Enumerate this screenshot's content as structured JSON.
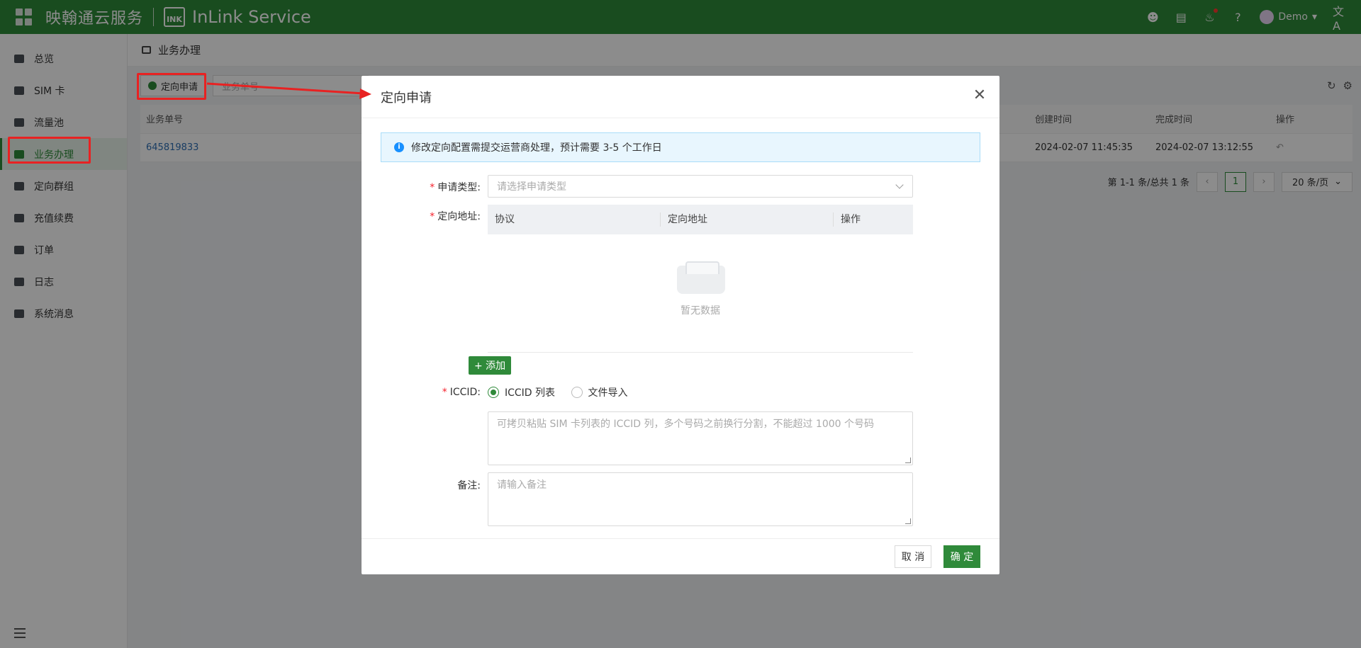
{
  "header": {
    "brand_cn": "映翰通云服务",
    "brand_en": "InLink Service",
    "logo_text": "INK",
    "user": "Demo",
    "user_caret": "▾",
    "lang_icon": "文A"
  },
  "sidebar": {
    "items": [
      {
        "label": "总览"
      },
      {
        "label": "SIM 卡"
      },
      {
        "label": "流量池"
      },
      {
        "label": "业务办理"
      },
      {
        "label": "定向群组"
      },
      {
        "label": "充值续费"
      },
      {
        "label": "订单"
      },
      {
        "label": "日志"
      },
      {
        "label": "系统消息"
      }
    ]
  },
  "page": {
    "title": "业务办理",
    "apply_button": "定向申请",
    "search_placeholder": "业务单号",
    "table": {
      "columns": [
        "业务单号",
        "创建时间",
        "完成时间",
        "操作"
      ],
      "rows": [
        {
          "order_no": "645819833",
          "created": "2024-02-07 11:45:35",
          "finished": "2024-02-07 13:12:55"
        }
      ]
    },
    "pager": {
      "summary": "第 1-1 条/总共 1 条",
      "current_page": "1",
      "page_size": "20 条/页"
    }
  },
  "modal": {
    "title": "定向申请",
    "notice": "修改定向配置需提交运营商处理，预计需要 3-5 个工作日",
    "apply_type_label": "申请类型:",
    "apply_type_placeholder": "请选择申请类型",
    "address_label": "定向地址:",
    "address_columns": [
      "协议",
      "定向地址",
      "操作"
    ],
    "empty_text": "暂无数据",
    "add_button": "+ 添加",
    "iccid_label": "ICCID:",
    "iccid_options": [
      "ICCID 列表",
      "文件导入"
    ],
    "iccid_placeholder": "可拷贝粘贴 SIM 卡列表的 ICCID 列，多个号码之前换行分割，不能超过 1000 个号码",
    "remark_label": "备注:",
    "remark_placeholder": "请输入备注",
    "cancel": "取 消",
    "ok": "确 定"
  }
}
